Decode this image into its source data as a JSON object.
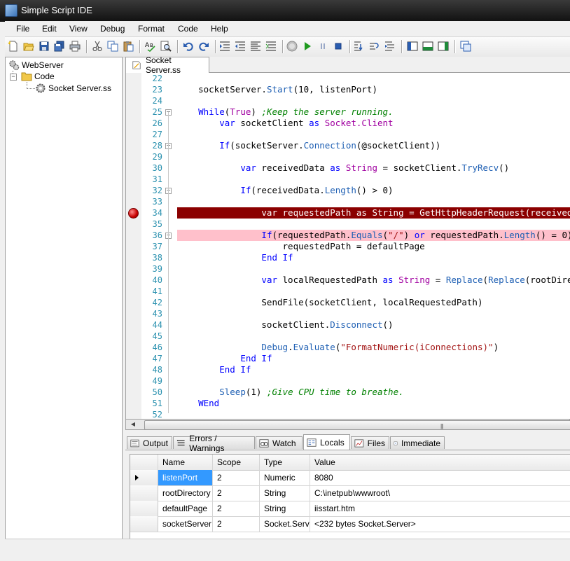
{
  "window": {
    "title": "Simple Script IDE"
  },
  "menu": [
    "File",
    "Edit",
    "View",
    "Debug",
    "Format",
    "Code",
    "Help"
  ],
  "toolbar": {
    "icons": [
      "new-file-icon",
      "open-folder-icon",
      "save-icon",
      "save-all-icon",
      "print-icon",
      "cut-icon",
      "copy-icon",
      "paste-icon",
      "spell-check-icon",
      "find-icon",
      "undo-icon",
      "redo-icon",
      "indent-icon",
      "outdent-icon",
      "align-icon",
      "comment-icon",
      "stop-icon",
      "run-icon",
      "pause-icon",
      "stop-square-icon",
      "step-into-icon",
      "step-over-icon",
      "step-out-icon",
      "panel-left-icon",
      "panel-bottom-icon",
      "panel-right-icon",
      "window-icon"
    ]
  },
  "tree": {
    "root": "WebServer",
    "folder": "Code",
    "file": "Socket Server.ss"
  },
  "doc_tab": {
    "label": "Socket Server.ss"
  },
  "editor": {
    "lines": [
      {
        "n": "22",
        "html": ""
      },
      {
        "n": "23",
        "html": "    socketServer.<span class='f'>Start</span>(10, listenPort)"
      },
      {
        "n": "24",
        "html": ""
      },
      {
        "n": "25",
        "html": "    <span class='k'>While</span>(<span class='t'>True</span>) <span class='c'>;Keep the server running.</span>",
        "fold": true
      },
      {
        "n": "26",
        "html": "        <span class='k'>var</span> socketClient <span class='k'>as</span> <span class='t'>Socket.Client</span>"
      },
      {
        "n": "27",
        "html": ""
      },
      {
        "n": "28",
        "html": "        <span class='k'>If</span>(socketServer.<span class='f'>Connection</span>(@socketClient))",
        "fold": true
      },
      {
        "n": "29",
        "html": ""
      },
      {
        "n": "30",
        "html": "            <span class='k'>var</span> receivedData <span class='k'>as</span> <span class='t'>String</span> = socketClient.<span class='f'>TryRecv</span>()"
      },
      {
        "n": "31",
        "html": ""
      },
      {
        "n": "32",
        "html": "            <span class='k'>If</span>(receivedData.<span class='f'>Length</span>() > 0)",
        "fold": true
      },
      {
        "n": "33",
        "html": ""
      },
      {
        "n": "34",
        "html": "                var requestedPath as String = GetHttpHeaderRequest(receivedData)",
        "bp": true
      },
      {
        "n": "35",
        "html": ""
      },
      {
        "n": "36",
        "html": "                <span class='k'>If</span>(requestedPath.<span class='f'>Equals</span>(<span class='s'>\"/\"</span>) <span class='k'>or</span> requestedPath.<span class='f'>Length</span>() = 0)",
        "fold": true,
        "cur": true
      },
      {
        "n": "37",
        "html": "                    requestedPath = defaultPage"
      },
      {
        "n": "38",
        "html": "                <span class='k'>End If</span>"
      },
      {
        "n": "39",
        "html": ""
      },
      {
        "n": "40",
        "html": "                <span class='k'>var</span> localRequestedPath <span class='k'>as</span> <span class='t'>String</span> = <span class='f'>Replace</span>(<span class='f'>Replace</span>(rootDirectory"
      },
      {
        "n": "41",
        "html": ""
      },
      {
        "n": "42",
        "html": "                SendFile(socketClient, localRequestedPath)"
      },
      {
        "n": "43",
        "html": ""
      },
      {
        "n": "44",
        "html": "                socketClient.<span class='f'>Disconnect</span>()"
      },
      {
        "n": "45",
        "html": ""
      },
      {
        "n": "46",
        "html": "                <span class='f'>Debug</span>.<span class='f'>Evaluate</span>(<span class='s'>\"FormatNumeric(iConnections)\"</span>)"
      },
      {
        "n": "47",
        "html": "            <span class='k'>End If</span>"
      },
      {
        "n": "48",
        "html": "        <span class='k'>End If</span>"
      },
      {
        "n": "49",
        "html": ""
      },
      {
        "n": "50",
        "html": "        <span class='f'>Sleep</span>(1) <span class='c'>;Give CPU time to breathe.</span>"
      },
      {
        "n": "51",
        "html": "    <span class='k'>WEnd</span>"
      },
      {
        "n": "52",
        "html": ""
      }
    ]
  },
  "panel_tabs": [
    {
      "label": "Output",
      "icon": "output-icon"
    },
    {
      "label": "Errors / Warnings",
      "icon": "errors-list-icon"
    },
    {
      "label": "Watch",
      "icon": "watch-icon"
    },
    {
      "label": "Locals",
      "icon": "locals-icon",
      "active": true
    },
    {
      "label": "Files",
      "icon": "files-icon"
    },
    {
      "label": "Immediate",
      "icon": "immediate-icon"
    }
  ],
  "locals": {
    "columns": [
      "Name",
      "Scope",
      "Type",
      "Value"
    ],
    "rows": [
      [
        "listenPort",
        "2",
        "Numeric",
        "8080"
      ],
      [
        "rootDirectory",
        "2",
        "String",
        "C:\\inetpub\\wwwroot\\"
      ],
      [
        "defaultPage",
        "2",
        "String",
        "iisstart.htm"
      ],
      [
        "socketServer",
        "2",
        "Socket.Server",
        "<232 bytes Socket.Server>"
      ]
    ]
  }
}
